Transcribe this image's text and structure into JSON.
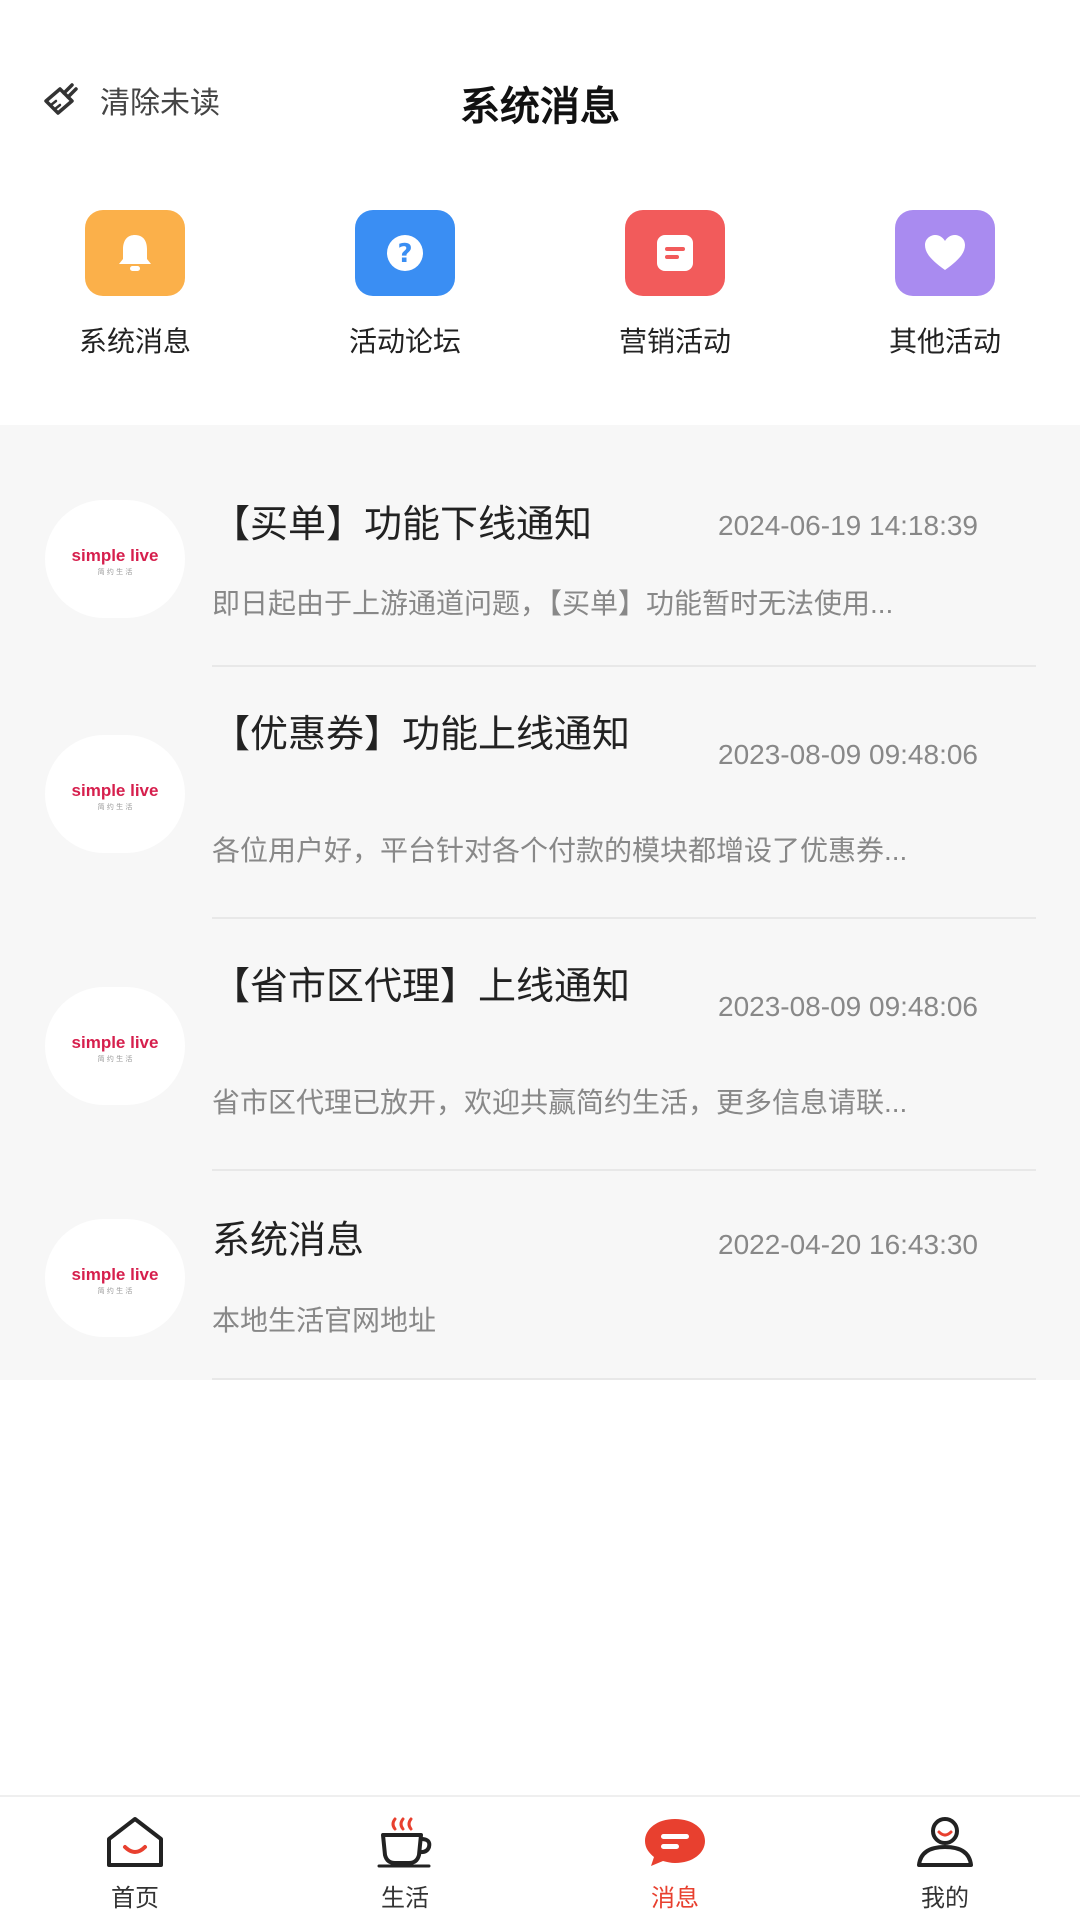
{
  "header": {
    "clear_unread_label": "清除未读",
    "title": "系统消息"
  },
  "categories": [
    {
      "label": "系统消息",
      "icon": "bell-icon",
      "color": "#FBB04A"
    },
    {
      "label": "活动论坛",
      "icon": "question-icon",
      "color": "#3A8EF3"
    },
    {
      "label": "营销活动",
      "icon": "note-icon",
      "color": "#F25B5B"
    },
    {
      "label": "其他活动",
      "icon": "heart-icon",
      "color": "#A98BF0"
    }
  ],
  "messages": [
    {
      "title": "【买单】功能下线通知",
      "time": "2024-06-19 14:18:39",
      "preview": "即日起由于上游通道问题，【买单】功能暂时无法使用..."
    },
    {
      "title": "【优惠券】功能上线通知",
      "time": "2023-08-09 09:48:06",
      "preview": "各位用户好，平台针对各个付款的模块都增设了优惠券..."
    },
    {
      "title": "【省市区代理】上线通知",
      "time": "2023-08-09 09:48:06",
      "preview": "省市区代理已放开，欢迎共赢简约生活，更多信息请联..."
    },
    {
      "title": "系统消息",
      "time": "2022-04-20 16:43:30",
      "preview": "本地生活官网地址"
    }
  ],
  "avatar_logo": {
    "text": "simple live",
    "sub": "简 约 生 活"
  },
  "tabbar": {
    "items": [
      {
        "label": "首页",
        "icon": "home-icon"
      },
      {
        "label": "生活",
        "icon": "coffee-cup-icon"
      },
      {
        "label": "消息",
        "icon": "message-icon",
        "active": true
      },
      {
        "label": "我的",
        "icon": "user-icon"
      }
    ],
    "active_color": "#E8402F"
  }
}
